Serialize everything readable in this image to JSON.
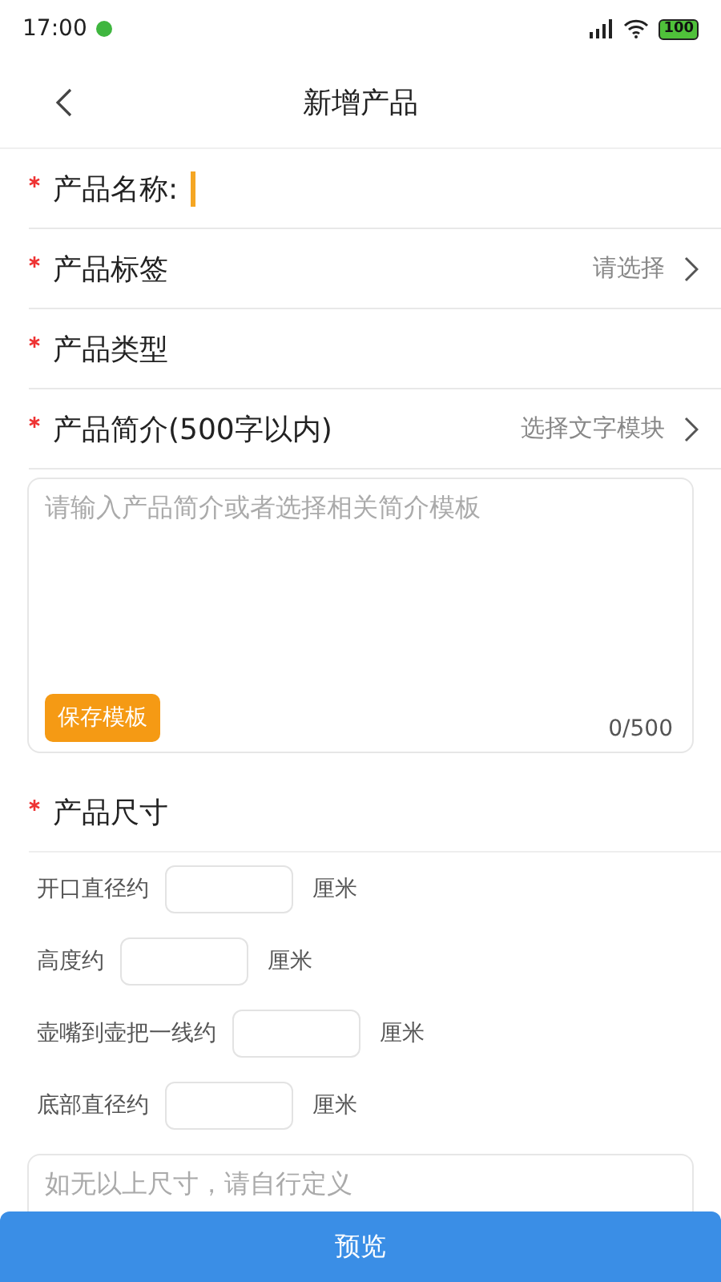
{
  "status_bar": {
    "time": "17:00",
    "battery": "100"
  },
  "header": {
    "title": "新增产品"
  },
  "fields": [
    {
      "kind": "input",
      "required": true,
      "label": "产品名称:",
      "focused": true
    },
    {
      "kind": "select",
      "required": true,
      "label": "产品标签",
      "hint": "请选择"
    },
    {
      "kind": "plain",
      "required": true,
      "label": "产品类型"
    },
    {
      "kind": "select",
      "required": true,
      "label": "产品简介(500字以内)",
      "hint": "选择文字模块"
    }
  ],
  "intro": {
    "placeholder": "请输入产品简介或者选择相关简介模板",
    "save_button": "保存模板",
    "counter": "0/500"
  },
  "size": {
    "required": true,
    "label": "产品尺寸",
    "measurements": [
      {
        "label": "开口直径约",
        "unit": "厘米"
      },
      {
        "label": "高度约",
        "unit": "厘米"
      },
      {
        "label": "壶嘴到壶把一线约",
        "unit": "厘米"
      },
      {
        "label": "底部直径约",
        "unit": "厘米"
      }
    ],
    "custom_placeholder": "如无以上尺寸，请自行定义"
  },
  "preview_button": "预览"
}
